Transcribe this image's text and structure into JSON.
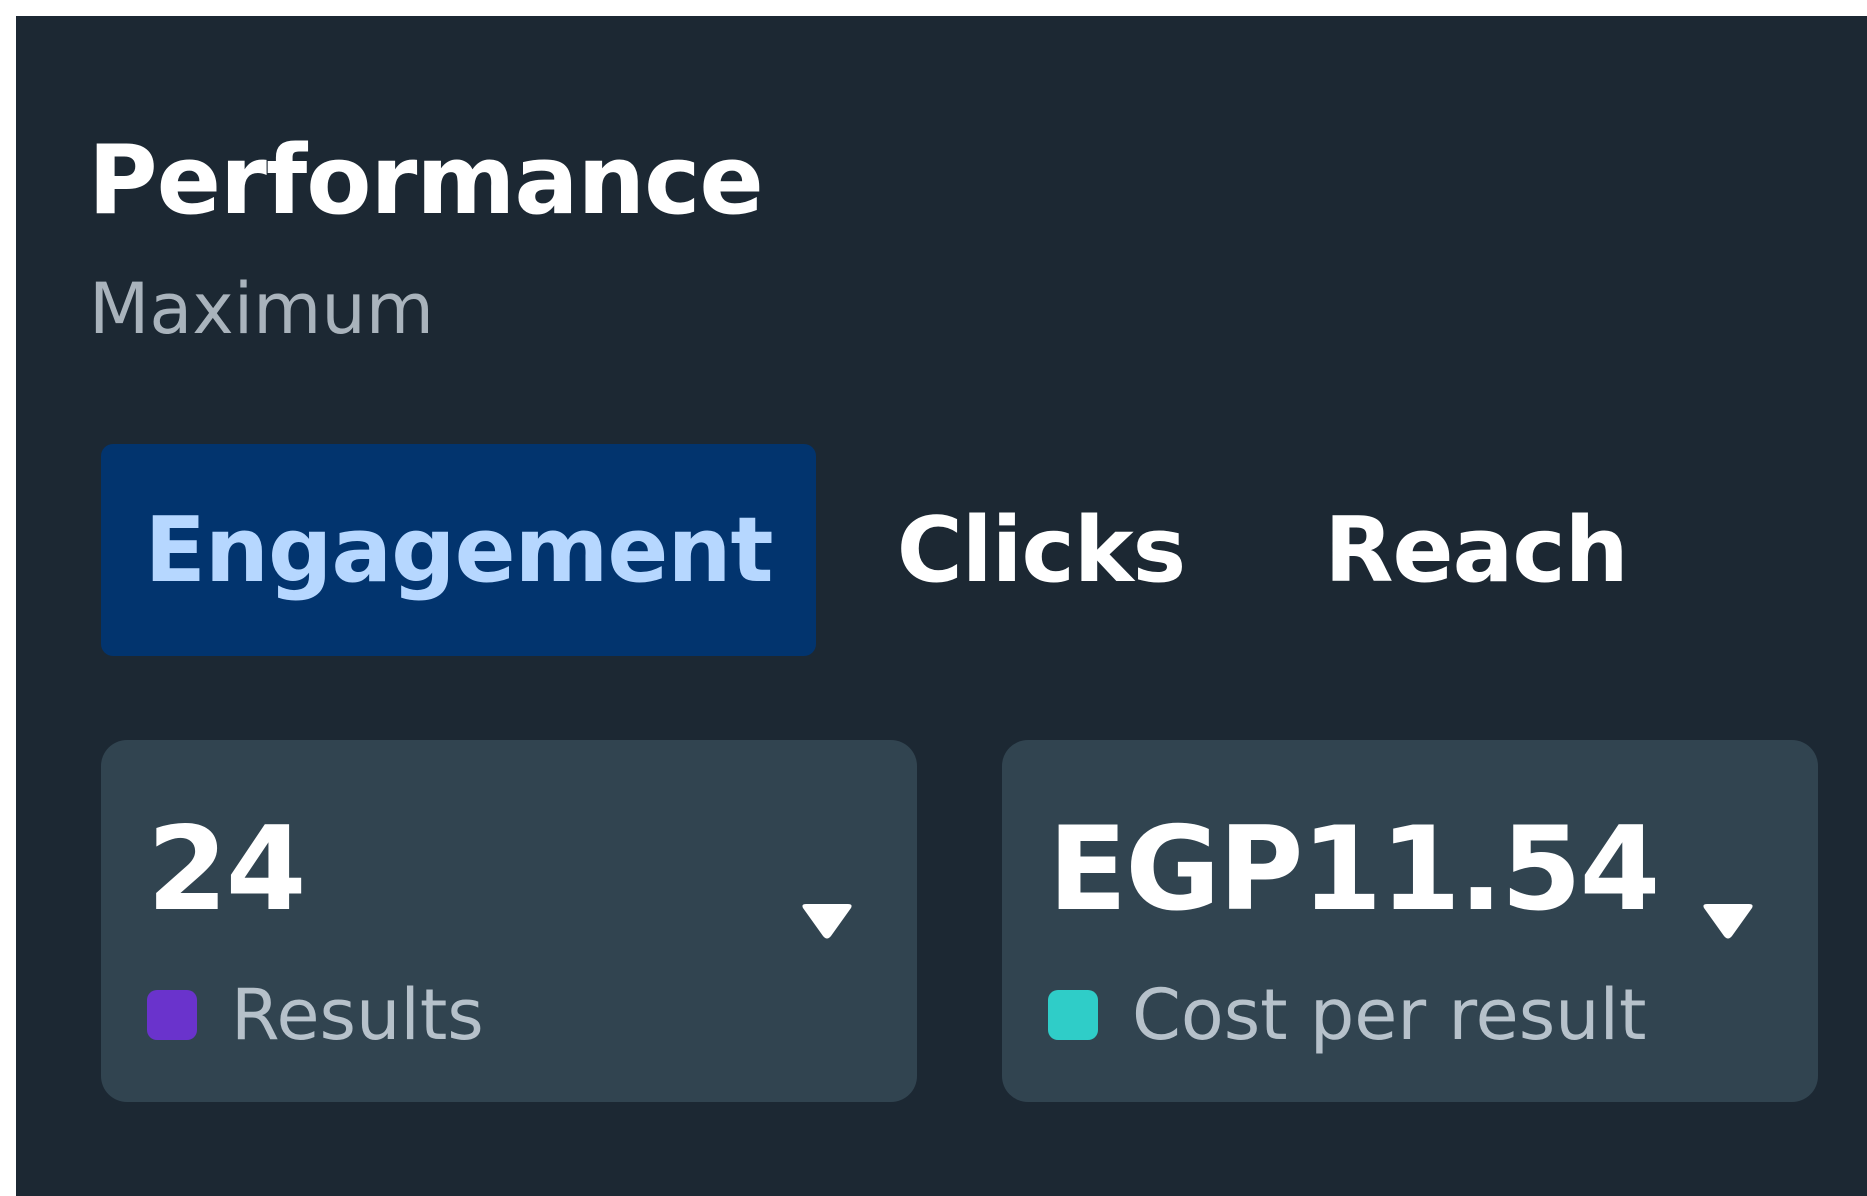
{
  "header": {
    "title": "Performance",
    "subtitle": "Maximum"
  },
  "tabs": [
    {
      "label": "Engagement",
      "active": true
    },
    {
      "label": "Clicks",
      "active": false
    },
    {
      "label": "Reach",
      "active": false
    }
  ],
  "metrics": [
    {
      "value": "24",
      "label": "Results",
      "color": "#6a33cc",
      "icon": "chevron-down-icon"
    },
    {
      "value": "EGP11.54",
      "label": "Cost per result",
      "color": "#2fcdc8",
      "icon": "chevron-down-icon"
    }
  ],
  "colors": {
    "background": "#1c2833",
    "card": "#314450",
    "active_tab_bg": "#02346e",
    "active_tab_text": "#b6d7ff"
  }
}
